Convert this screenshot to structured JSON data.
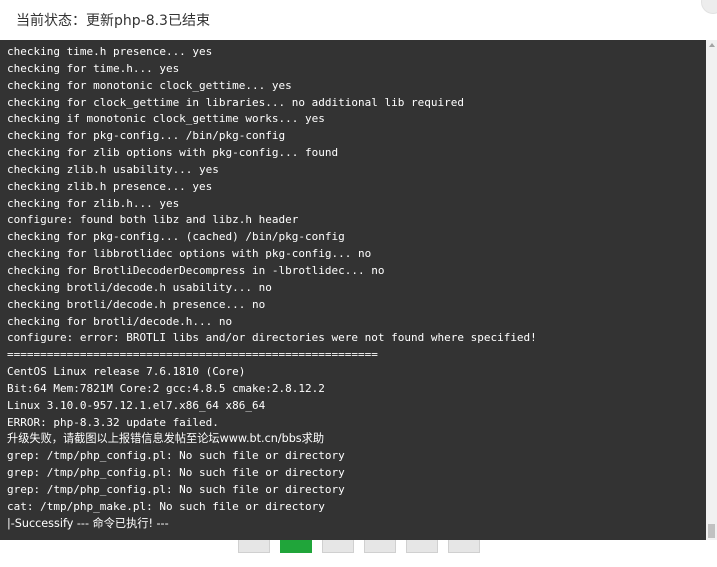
{
  "dialog": {
    "title": "当前状态：更新php-8.3已结束"
  },
  "console": {
    "lines": [
      "checking time.h presence... yes",
      "checking for time.h... yes",
      "checking for monotonic clock_gettime... yes",
      "checking for clock_gettime in libraries... no additional lib required",
      "checking if monotonic clock_gettime works... yes",
      "checking for pkg-config... /bin/pkg-config",
      "checking for zlib options with pkg-config... found",
      "checking zlib.h usability... yes",
      "checking zlib.h presence... yes",
      "checking for zlib.h... yes",
      "configure: found both libz and libz.h header",
      "checking for pkg-config... (cached) /bin/pkg-config",
      "checking for libbrotlidec options with pkg-config... no",
      "checking for BrotliDecoderDecompress in -lbrotlidec... no",
      "checking brotli/decode.h usability... no",
      "checking brotli/decode.h presence... no",
      "checking for brotli/decode.h... no",
      "configure: error: BROTLI libs and/or directories were not found where specified!",
      "========================================================",
      "CentOS Linux release 7.6.1810 (Core)",
      "Bit:64 Mem:7821M Core:2 gcc:4.8.5 cmake:2.8.12.2",
      "Linux 3.10.0-957.12.1.el7.x86_64 x86_64",
      "ERROR: php-8.3.32 update failed.",
      "升级失败，请截图以上报错信息发帖至论坛www.bt.cn/bbs求助",
      "grep: /tmp/php_config.pl: No such file or directory",
      "grep: /tmp/php_config.pl: No such file or directory",
      "grep: /tmp/php_config.pl: No such file or directory",
      "cat: /tmp/php_make.pl: No such file or directory",
      "|-Successify --- 命令已执行! ---"
    ]
  },
  "colors": {
    "console_bg": "#333333",
    "console_text": "#ffffff",
    "accent": "#20a53a"
  }
}
